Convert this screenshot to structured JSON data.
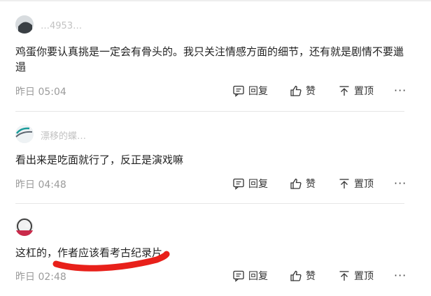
{
  "comments": [
    {
      "username": "…4953…",
      "text": "鸡蛋你要认真挑是一定会有骨头的。我只关注情感方面的细节，还有就是剧情不要邋遢",
      "time": "昨日 05:04"
    },
    {
      "username": "漂移的蝶…",
      "text": "看出来是吃面就行了，反正是演戏嘛",
      "time": "昨日 04:48"
    },
    {
      "username": "",
      "text": "这杠的，作者应该看考古纪录片。",
      "time": "昨日 02:48"
    }
  ],
  "actions": {
    "reply": "回复",
    "like": "赞",
    "pin": "置顶",
    "more": "···"
  },
  "colors": {
    "annotation": "#e8201a",
    "meta": "#9b9b9b",
    "text": "#222222"
  }
}
